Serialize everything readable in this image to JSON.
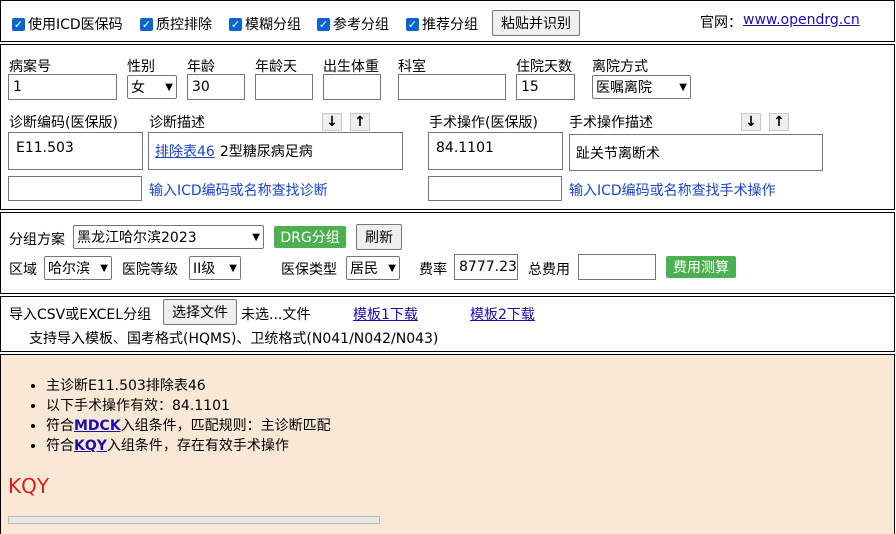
{
  "toolbar": {
    "options": [
      {
        "label": "使用ICD医保码",
        "checked": true
      },
      {
        "label": "质控排除",
        "checked": true
      },
      {
        "label": "模糊分组",
        "checked": true
      },
      {
        "label": "参考分组",
        "checked": true
      },
      {
        "label": "推荐分组",
        "checked": true
      }
    ],
    "paste_button": "粘贴并识别",
    "site_label": "官网：",
    "site_link": "www.opendrg.cn"
  },
  "patient": {
    "labels": {
      "case_no": "病案号",
      "gender": "性别",
      "age": "年龄",
      "age_days": "年龄天",
      "birth_weight": "出生体重",
      "department": "科室",
      "stay_days": "住院天数",
      "discharge": "离院方式"
    },
    "values": {
      "case_no": "1",
      "gender": "女",
      "age": "30",
      "age_days": "",
      "birth_weight": "",
      "department": "",
      "stay_days": "15",
      "discharge": "医嘱离院"
    }
  },
  "diagnosis": {
    "code_label": "诊断编码(医保版)",
    "desc_label": "诊断描述",
    "code_value": "E11.503",
    "desc_link": "排除表46",
    "desc_text": "2型糖尿病足病",
    "search_hint": "输入ICD编码或名称查找诊断"
  },
  "operation": {
    "code_label": "手术操作(医保版)",
    "desc_label": "手术操作描述",
    "code_value": "84.1101",
    "desc_text": "趾关节离断术",
    "search_hint": "输入ICD编码或名称查找手术操作"
  },
  "arrows": {
    "down": "↓",
    "up": "↑"
  },
  "grouping": {
    "scheme_label": "分组方案",
    "scheme_value": "黑龙江哈尔滨2023",
    "drg_button": "DRG分组",
    "refresh_button": "刷新",
    "region_label": "区域",
    "region_value": "哈尔滨",
    "hospital_level_label": "医院等级",
    "hospital_level_value": "II级",
    "insurance_type_label": "医保类型",
    "insurance_type_value": "居民",
    "rate_label": "费率",
    "rate_value": "8777.23",
    "total_label": "总费用",
    "total_value": "",
    "calc_button": "费用测算"
  },
  "import": {
    "label": "导入CSV或EXCEL分组",
    "choose_button": "选择文件",
    "no_file": "未选...文件",
    "template1": "模板1下载",
    "template2": "模板2下载",
    "support_text": "支持导入模板、国考格式(HQMS)、卫统格式(N041/N042/N043)"
  },
  "result": {
    "line1": "主诊断E11.503排除表46",
    "line2": "以下手术操作有效：84.1101",
    "line3_pre": "符合",
    "line3_link": "MDCK",
    "line3_post": "入组条件，匹配规则：主诊断匹配",
    "line4_pre": "符合",
    "line4_link": "KQY",
    "line4_post": "入组条件，存在有效手术操作",
    "group_code": "KQY"
  },
  "colors": {
    "result_bg": "#fae8d6",
    "accent_green": "#4caf50",
    "hint_blue": "#1a46c9",
    "group_red": "#e21a1a",
    "checkbox_blue": "#0a63d1"
  }
}
